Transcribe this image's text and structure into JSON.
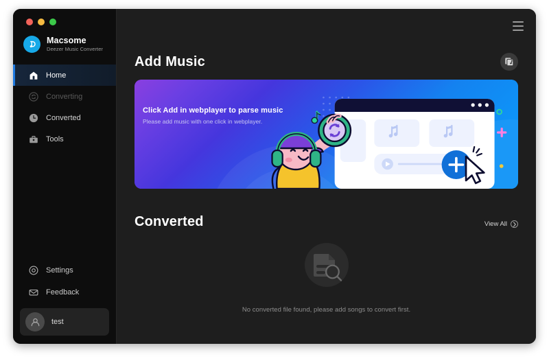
{
  "window": {
    "traffic_lights": [
      {
        "name": "close",
        "color": "#f2635a"
      },
      {
        "name": "minimize",
        "color": "#f5bb42"
      },
      {
        "name": "maximize",
        "color": "#3cc94a"
      }
    ]
  },
  "brand": {
    "name": "Macsome",
    "subtitle": "Deezer Music Converter",
    "logo_icon": "macsome-d-note-logo",
    "logo_color": "#17a9e8"
  },
  "sidebar": {
    "items": [
      {
        "label": "Home",
        "icon": "home-icon",
        "active": true,
        "disabled": false
      },
      {
        "label": "Converting",
        "icon": "converting-icon",
        "active": false,
        "disabled": true
      },
      {
        "label": "Converted",
        "icon": "converted-clock-icon",
        "active": false,
        "disabled": false
      },
      {
        "label": "Tools",
        "icon": "tools-toolbox-icon",
        "active": false,
        "disabled": false
      }
    ],
    "bottom_items": [
      {
        "label": "Settings",
        "icon": "settings-gear-icon"
      },
      {
        "label": "Feedback",
        "icon": "feedback-envelope-icon"
      }
    ],
    "user": {
      "name": "test",
      "icon": "user-avatar-icon"
    },
    "active_accent": "#1f7ae0"
  },
  "header": {
    "menu_icon": "hamburger-menu-icon"
  },
  "add_music": {
    "title": "Add Music",
    "action_icon": "music-library-icon",
    "banner": {
      "title": "Click Add in webplayer to parse music",
      "subtitle": "Please add music with one click in webplayer.",
      "gradient_from": "#8a3fe0",
      "gradient_to": "#0e93f7",
      "illustration": "person-with-headphones-and-webplayer-window",
      "cursor_icon": "mouse-cursor-icon",
      "add_button_icon": "plus-icon"
    }
  },
  "converted": {
    "title": "Converted",
    "view_all_label": "View All",
    "view_all_icon": "chevron-right-icon",
    "empty_icon": "document-search-icon",
    "empty_message": "No converted file found, please add songs to convert first."
  }
}
